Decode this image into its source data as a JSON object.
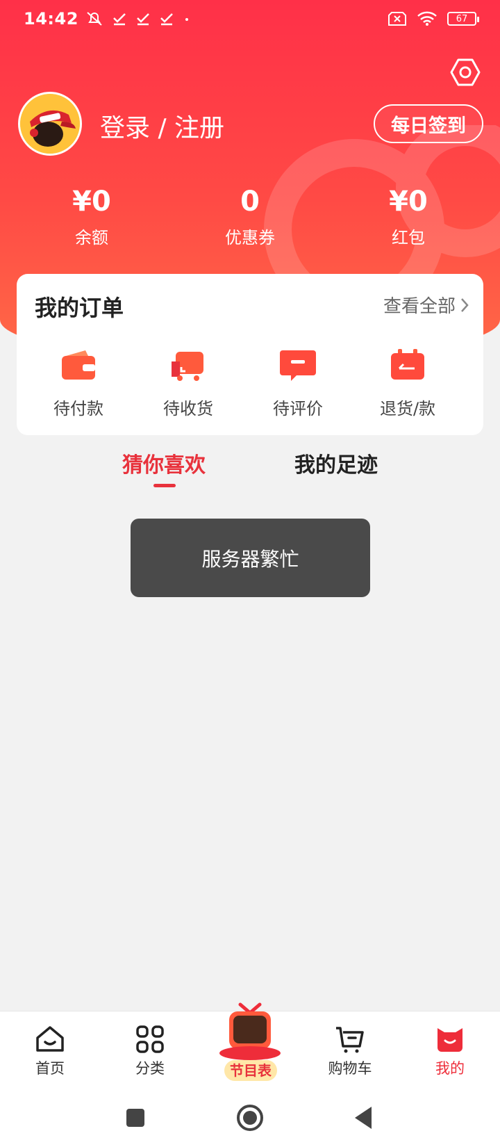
{
  "status_bar": {
    "time": "14:42",
    "battery": "67",
    "left_icons": [
      "mute-notifications-icon",
      "check-icon",
      "check-icon",
      "check-icon",
      "dot-icon"
    ],
    "right_icons": [
      "sim-error-icon",
      "wifi-icon",
      "battery-icon"
    ]
  },
  "profile": {
    "login_text": "登录 / 注册",
    "checkin_label": "每日签到"
  },
  "stats": [
    {
      "value": "¥0",
      "label": "余额"
    },
    {
      "value": "0",
      "label": "优惠券"
    },
    {
      "value": "¥0",
      "label": "红包"
    }
  ],
  "orders": {
    "title": "我的订单",
    "view_all": "查看全部",
    "items": [
      {
        "label": "待付款",
        "icon": "wallet-icon"
      },
      {
        "label": "待收货",
        "icon": "truck-icon"
      },
      {
        "label": "待评价",
        "icon": "comment-icon"
      },
      {
        "label": "退货/款",
        "icon": "return-icon"
      }
    ]
  },
  "tabs": {
    "guess": "猜你喜欢",
    "footprint": "我的足迹"
  },
  "toast": "服务器繁忙",
  "bottom_nav": [
    {
      "label": "首页",
      "icon": "home-icon"
    },
    {
      "label": "分类",
      "icon": "category-icon"
    },
    {
      "label": "节目表",
      "icon": "tv-icon"
    },
    {
      "label": "购物车",
      "icon": "cart-icon"
    },
    {
      "label": "我的",
      "icon": "profile-cat-icon",
      "active": true
    }
  ],
  "colors": {
    "brand_red": "#ff3048",
    "accent_red": "#e8323c",
    "toast_bg": "#4a4a4a"
  }
}
